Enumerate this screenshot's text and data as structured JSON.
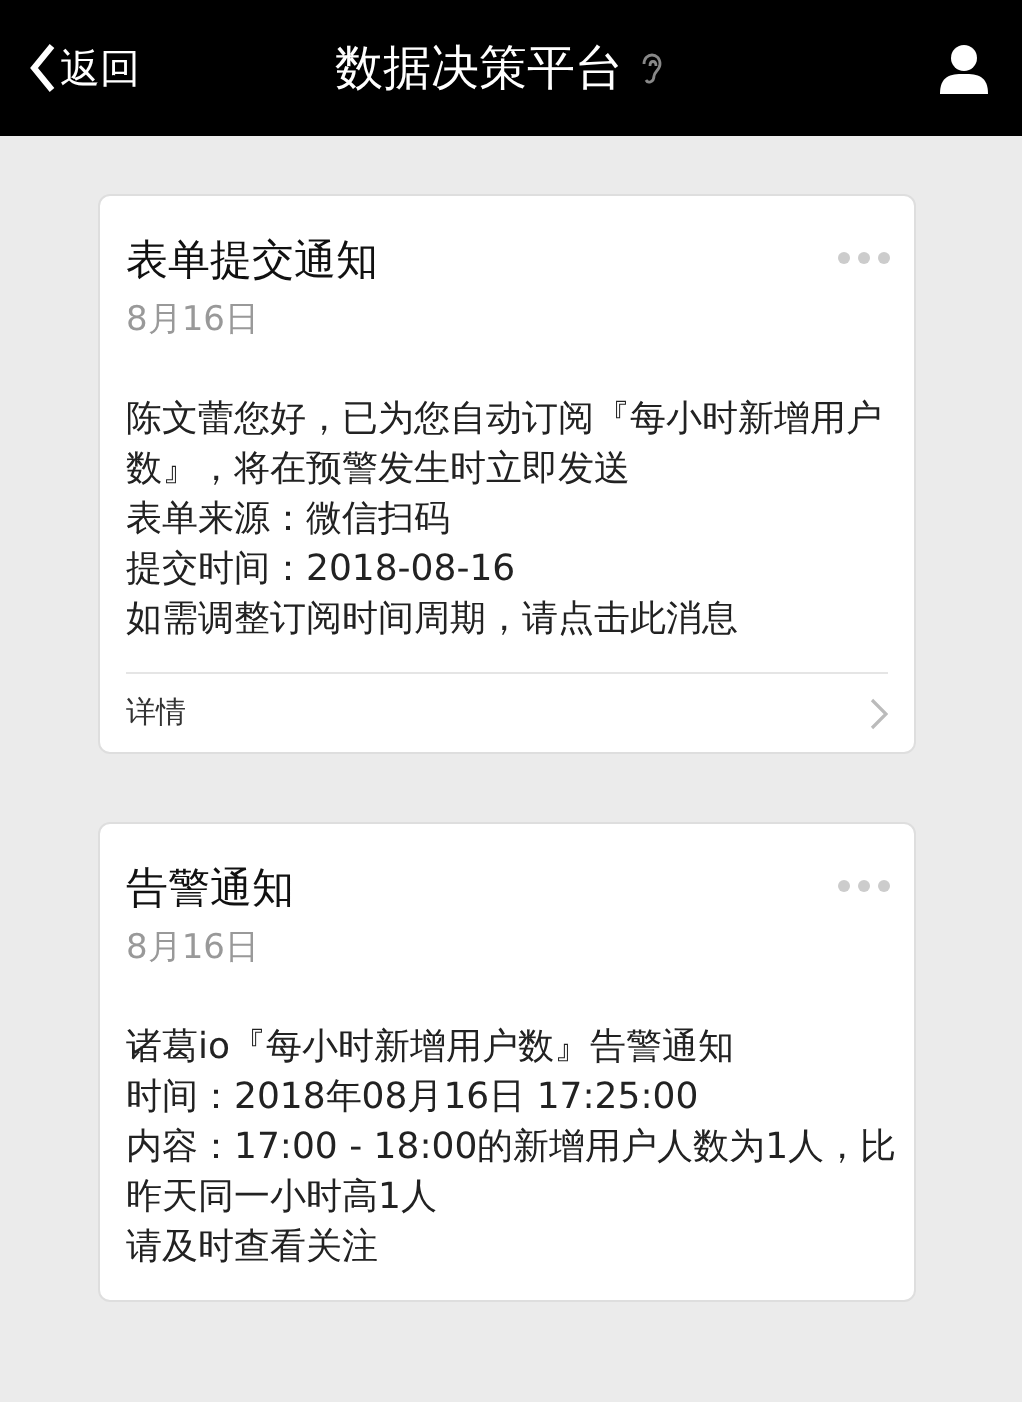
{
  "header": {
    "back_label": "返回",
    "title": "数据决策平台"
  },
  "cards": [
    {
      "title": "表单提交通知",
      "date": "8月16日",
      "lines": [
        "陈文蕾您好，已为您自动订阅『每小时新增用户数』，将在预警发生时立即发送",
        "表单来源：微信扫码",
        "提交时间：2018-08-16",
        "如需调整订阅时间周期，请点击此消息"
      ],
      "footer": "详情"
    },
    {
      "title": "告警通知",
      "date": "8月16日",
      "lines": [
        "诸葛io『每小时新增用户数』告警通知",
        "时间：2018年08月16日 17:25:00",
        "内容：17:00 - 18:00的新增用户人数为1人，比昨天同一小时高1人",
        "请及时查看关注"
      ]
    }
  ]
}
